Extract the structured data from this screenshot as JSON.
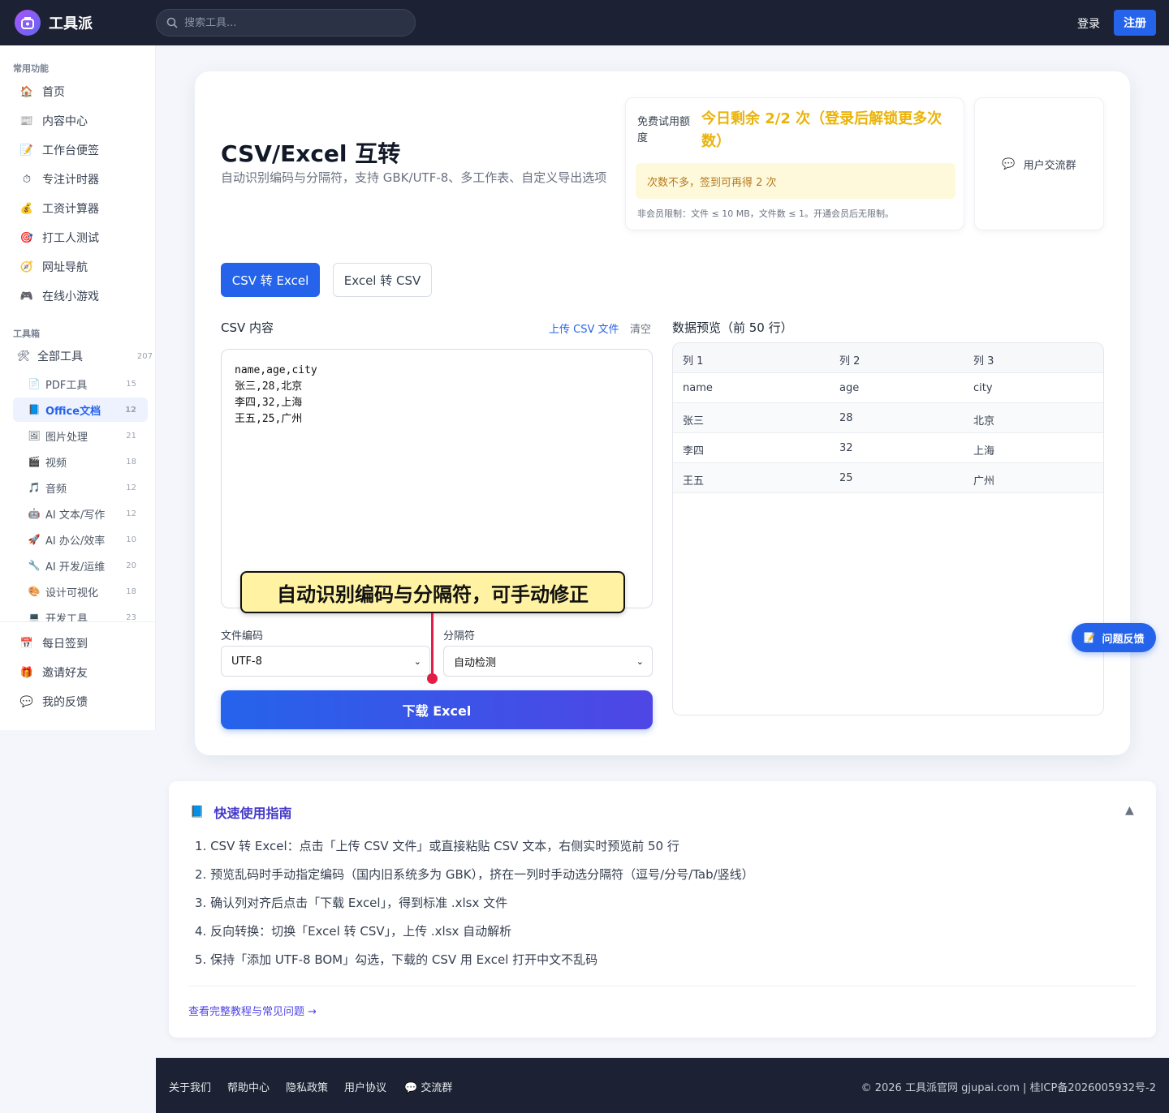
{
  "brand": {
    "name": "工具派"
  },
  "search": {
    "placeholder": "搜索工具..."
  },
  "auth": {
    "login": "登录",
    "register": "注册"
  },
  "sidebar": {
    "section_common": "常用功能",
    "common": [
      {
        "icon": "🏠",
        "label": "首页"
      },
      {
        "icon": "📰",
        "label": "内容中心"
      },
      {
        "icon": "📝",
        "label": "工作台便签"
      },
      {
        "icon": "⏱",
        "label": "专注计时器"
      },
      {
        "icon": "💰",
        "label": "工资计算器"
      },
      {
        "icon": "🎯",
        "label": "打工人测试"
      },
      {
        "icon": "🧭",
        "label": "网址导航"
      },
      {
        "icon": "🎮",
        "label": "在线小游戏"
      }
    ],
    "section_tools": "工具箱",
    "all_tools": {
      "icon": "🛠",
      "label": "全部工具",
      "count": "207"
    },
    "tools": [
      {
        "icon": "📄",
        "label": "PDF工具",
        "count": "15"
      },
      {
        "icon": "📘",
        "label": "Office文档",
        "count": "12"
      },
      {
        "icon": "🖼",
        "label": "图片处理",
        "count": "21"
      },
      {
        "icon": "🎬",
        "label": "视频",
        "count": "18"
      },
      {
        "icon": "🎵",
        "label": "音频",
        "count": "12"
      },
      {
        "icon": "🤖",
        "label": "AI 文本/写作",
        "count": "12"
      },
      {
        "icon": "🚀",
        "label": "AI 办公/效率",
        "count": "10"
      },
      {
        "icon": "🔧",
        "label": "AI 开发/运维",
        "count": "20"
      },
      {
        "icon": "🎨",
        "label": "设计可视化",
        "count": "18"
      },
      {
        "icon": "💻",
        "label": "开发工具",
        "count": "23"
      }
    ],
    "bottom": [
      {
        "icon": "📅",
        "label": "每日签到"
      },
      {
        "icon": "🎁",
        "label": "邀请好友"
      },
      {
        "icon": "💬",
        "label": "我的反馈"
      }
    ]
  },
  "page": {
    "title": "CSV/Excel 互转",
    "subtitle": "自动识别编码与分隔符，支持 GBK/UTF-8、多工作表、自定义导出选项"
  },
  "quota": {
    "label": "免费试用额度",
    "value": "今日剩余 2/2 次（登录后解锁更多次数）",
    "tip": "次数不多，签到可再得 2 次",
    "note": "非会员限制：文件 ≤ 10 MB，文件数 ≤ 1。开通会员后无限制。"
  },
  "group": {
    "icon": "💬",
    "label": "用户交流群"
  },
  "tabs": [
    {
      "label": "CSV 转 Excel"
    },
    {
      "label": "Excel 转 CSV"
    }
  ],
  "csv": {
    "label": "CSV 内容",
    "upload": "上传 CSV 文件",
    "clear": "清空",
    "lines": [
      "name,age,city",
      "张三,28,北京",
      "李四,32,上海",
      "王五,25,广州"
    ]
  },
  "tooltip": "自动识别编码与分隔符，可手动修正",
  "encoding": {
    "label": "文件编码",
    "value": "UTF-8"
  },
  "delimiter": {
    "label": "分隔符",
    "value": "自动检测"
  },
  "download": "下载 Excel",
  "preview": {
    "label": "数据预览（前 50 行）",
    "headers": [
      "列 1",
      "列 2",
      "列 3"
    ],
    "rows": [
      [
        "name",
        "age",
        "city"
      ],
      [
        "张三",
        "28",
        "北京"
      ],
      [
        "李四",
        "32",
        "上海"
      ],
      [
        "王五",
        "25",
        "广州"
      ]
    ]
  },
  "guide": {
    "icon": "📘",
    "title": "快速使用指南",
    "toggle": "▲",
    "steps": [
      "1. CSV 转 Excel：点击「上传 CSV 文件」或直接粘贴 CSV 文本，右侧实时预览前 50 行",
      "2. 预览乱码时手动指定编码（国内旧系统多为 GBK），挤在一列时手动选分隔符（逗号/分号/Tab/竖线）",
      "3. 确认列对齐后点击「下载 Excel」，得到标准 .xlsx 文件",
      "4. 反向转换：切换「Excel 转 CSV」，上传 .xlsx 自动解析",
      "5. 保持「添加 UTF-8 BOM」勾选，下载的 CSV 用 Excel 打开中文不乱码"
    ],
    "link": "查看完整教程与常见问题 →"
  },
  "feedback": {
    "icon": "📝",
    "label": "问题反馈"
  },
  "footer": {
    "links": [
      "关于我们",
      "帮助中心",
      "隐私政策",
      "用户协议",
      "💬 交流群"
    ],
    "copyright": "© 2026 工具派官网 gjupai.com | 桂ICP备2026005932号-2"
  }
}
